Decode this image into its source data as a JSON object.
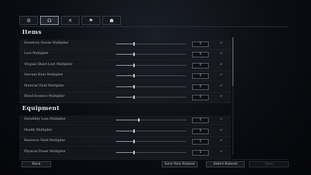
{
  "tabs": [
    {
      "icon": "gear-icon",
      "glyph": "⚙",
      "active": false
    },
    {
      "icon": "character-icon",
      "glyph": "☊",
      "active": true
    },
    {
      "icon": "crossed-swords-icon",
      "glyph": "✕",
      "active": false
    },
    {
      "icon": "castle-icon",
      "glyph": "⚑",
      "active": false
    },
    {
      "icon": "servant-icon",
      "glyph": "☗",
      "active": false
    }
  ],
  "sections": {
    "items": {
      "title": "Items",
      "rows": [
        {
          "label": "Inventory Stacks Multiplier",
          "value": "1",
          "level": 0.26
        },
        {
          "label": "Loot Multiplier",
          "value": "1",
          "level": 0.26
        },
        {
          "label": "Stygian Shard Loot Multiplier",
          "value": "1",
          "level": 0.26
        },
        {
          "label": "Servant Hunt Multiplier",
          "value": "1",
          "level": 0.26
        },
        {
          "label": "Material Yield Multiplier",
          "value": "1",
          "level": 0.26
        },
        {
          "label": "Blood Essence Multiplier",
          "value": "1",
          "level": 0.26
        }
      ]
    },
    "equipment": {
      "title": "Equipment",
      "rows": [
        {
          "label": "Durability Loss Multiplier",
          "value": "1",
          "level": 0.33
        },
        {
          "label": "Health Multiplier",
          "value": "1",
          "level": 0.26
        },
        {
          "label": "Resource Yield Multiplier",
          "value": "1",
          "level": 0.26
        },
        {
          "label": "Physical Power Multiplier",
          "value": "1",
          "level": 0.26
        }
      ]
    }
  },
  "reset_glyph": "↶",
  "footer": {
    "back": "Back",
    "save_new_ruleset": "Save New Ruleset",
    "select_ruleset": "Select Ruleset",
    "save": "Save"
  }
}
